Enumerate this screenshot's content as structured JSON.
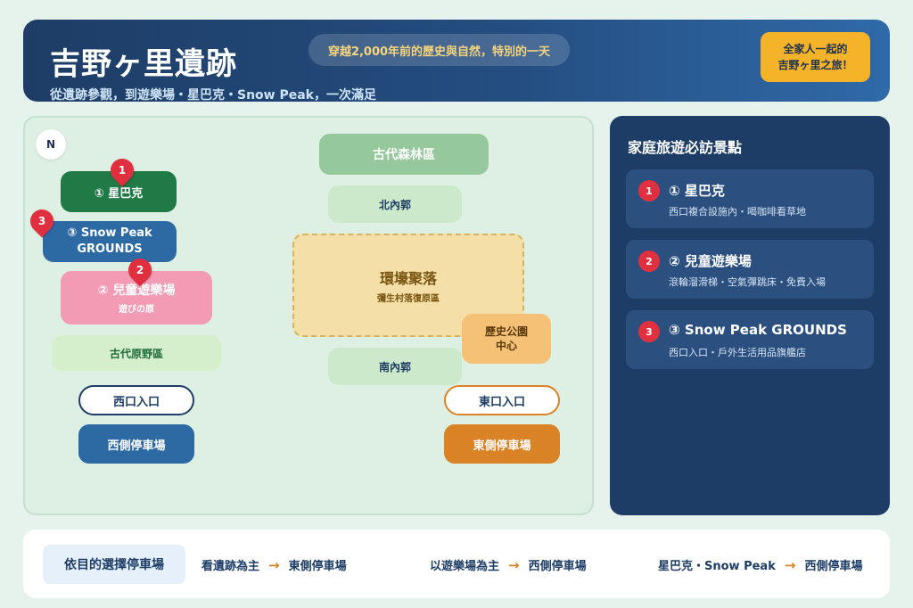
{
  "header": {
    "title": "吉野ヶ里遺跡",
    "subtitle": "從遺跡參觀，到遊樂場・星巴克・Snow Peak，一次滿足",
    "tagline": "穿越2,000年前的歷史與自然，特別的一天",
    "badge_line1": "全家人一起的",
    "badge_line2": "吉野ヶ里之旅！"
  },
  "map": {
    "north_label": "N",
    "ancient_forest": "古代森林區",
    "north_inner": "北內郭",
    "moat_village": "環壕聚落",
    "moat_village_sub": "彌生村落復原區",
    "history_center_line1": "歷史公園",
    "history_center_line2": "中心",
    "south_inner": "南內郭",
    "east_gate": "東口入口",
    "east_parking": "東側停車場",
    "starbucks": "① 星巴克",
    "snowpeak_line1": "③ Snow Peak",
    "snowpeak_line2": "GROUNDS",
    "playground": "② 兒童遊樂場",
    "playground_sub": "遊びの原",
    "ancient_plain": "古代原野區",
    "west_gate": "西口入口",
    "west_parking": "西側停車場",
    "pin_1": "1",
    "pin_2": "2",
    "pin_3": "3"
  },
  "spots": {
    "title": "家庭旅遊必訪景點",
    "items": [
      {
        "num": "1",
        "name": "① 星巴克",
        "desc": "西口複合設施內・喝咖啡看草地"
      },
      {
        "num": "2",
        "name": "② 兒童遊樂場",
        "desc": "滾輪溜滑梯・空氣彈跳床・免費入場"
      },
      {
        "num": "3",
        "name": "③ Snow Peak GROUNDS",
        "desc": "西口入口・戶外生活用品旗艦店"
      }
    ]
  },
  "parking_guide": {
    "label": "依目的選擇停車場",
    "arrow": "→",
    "rules": [
      {
        "purpose": "看遺跡為主",
        "lot": "東側停車場"
      },
      {
        "purpose": "以遊樂場為主",
        "lot": "西側停車場"
      },
      {
        "purpose": "星巴克・Snow Peak",
        "lot": "西側停車場"
      }
    ]
  },
  "colors": {
    "navy": "#1d3d66",
    "accent_orange": "#d98226",
    "pin_red": "#e0303f",
    "badge_yellow": "#f5b32a"
  }
}
